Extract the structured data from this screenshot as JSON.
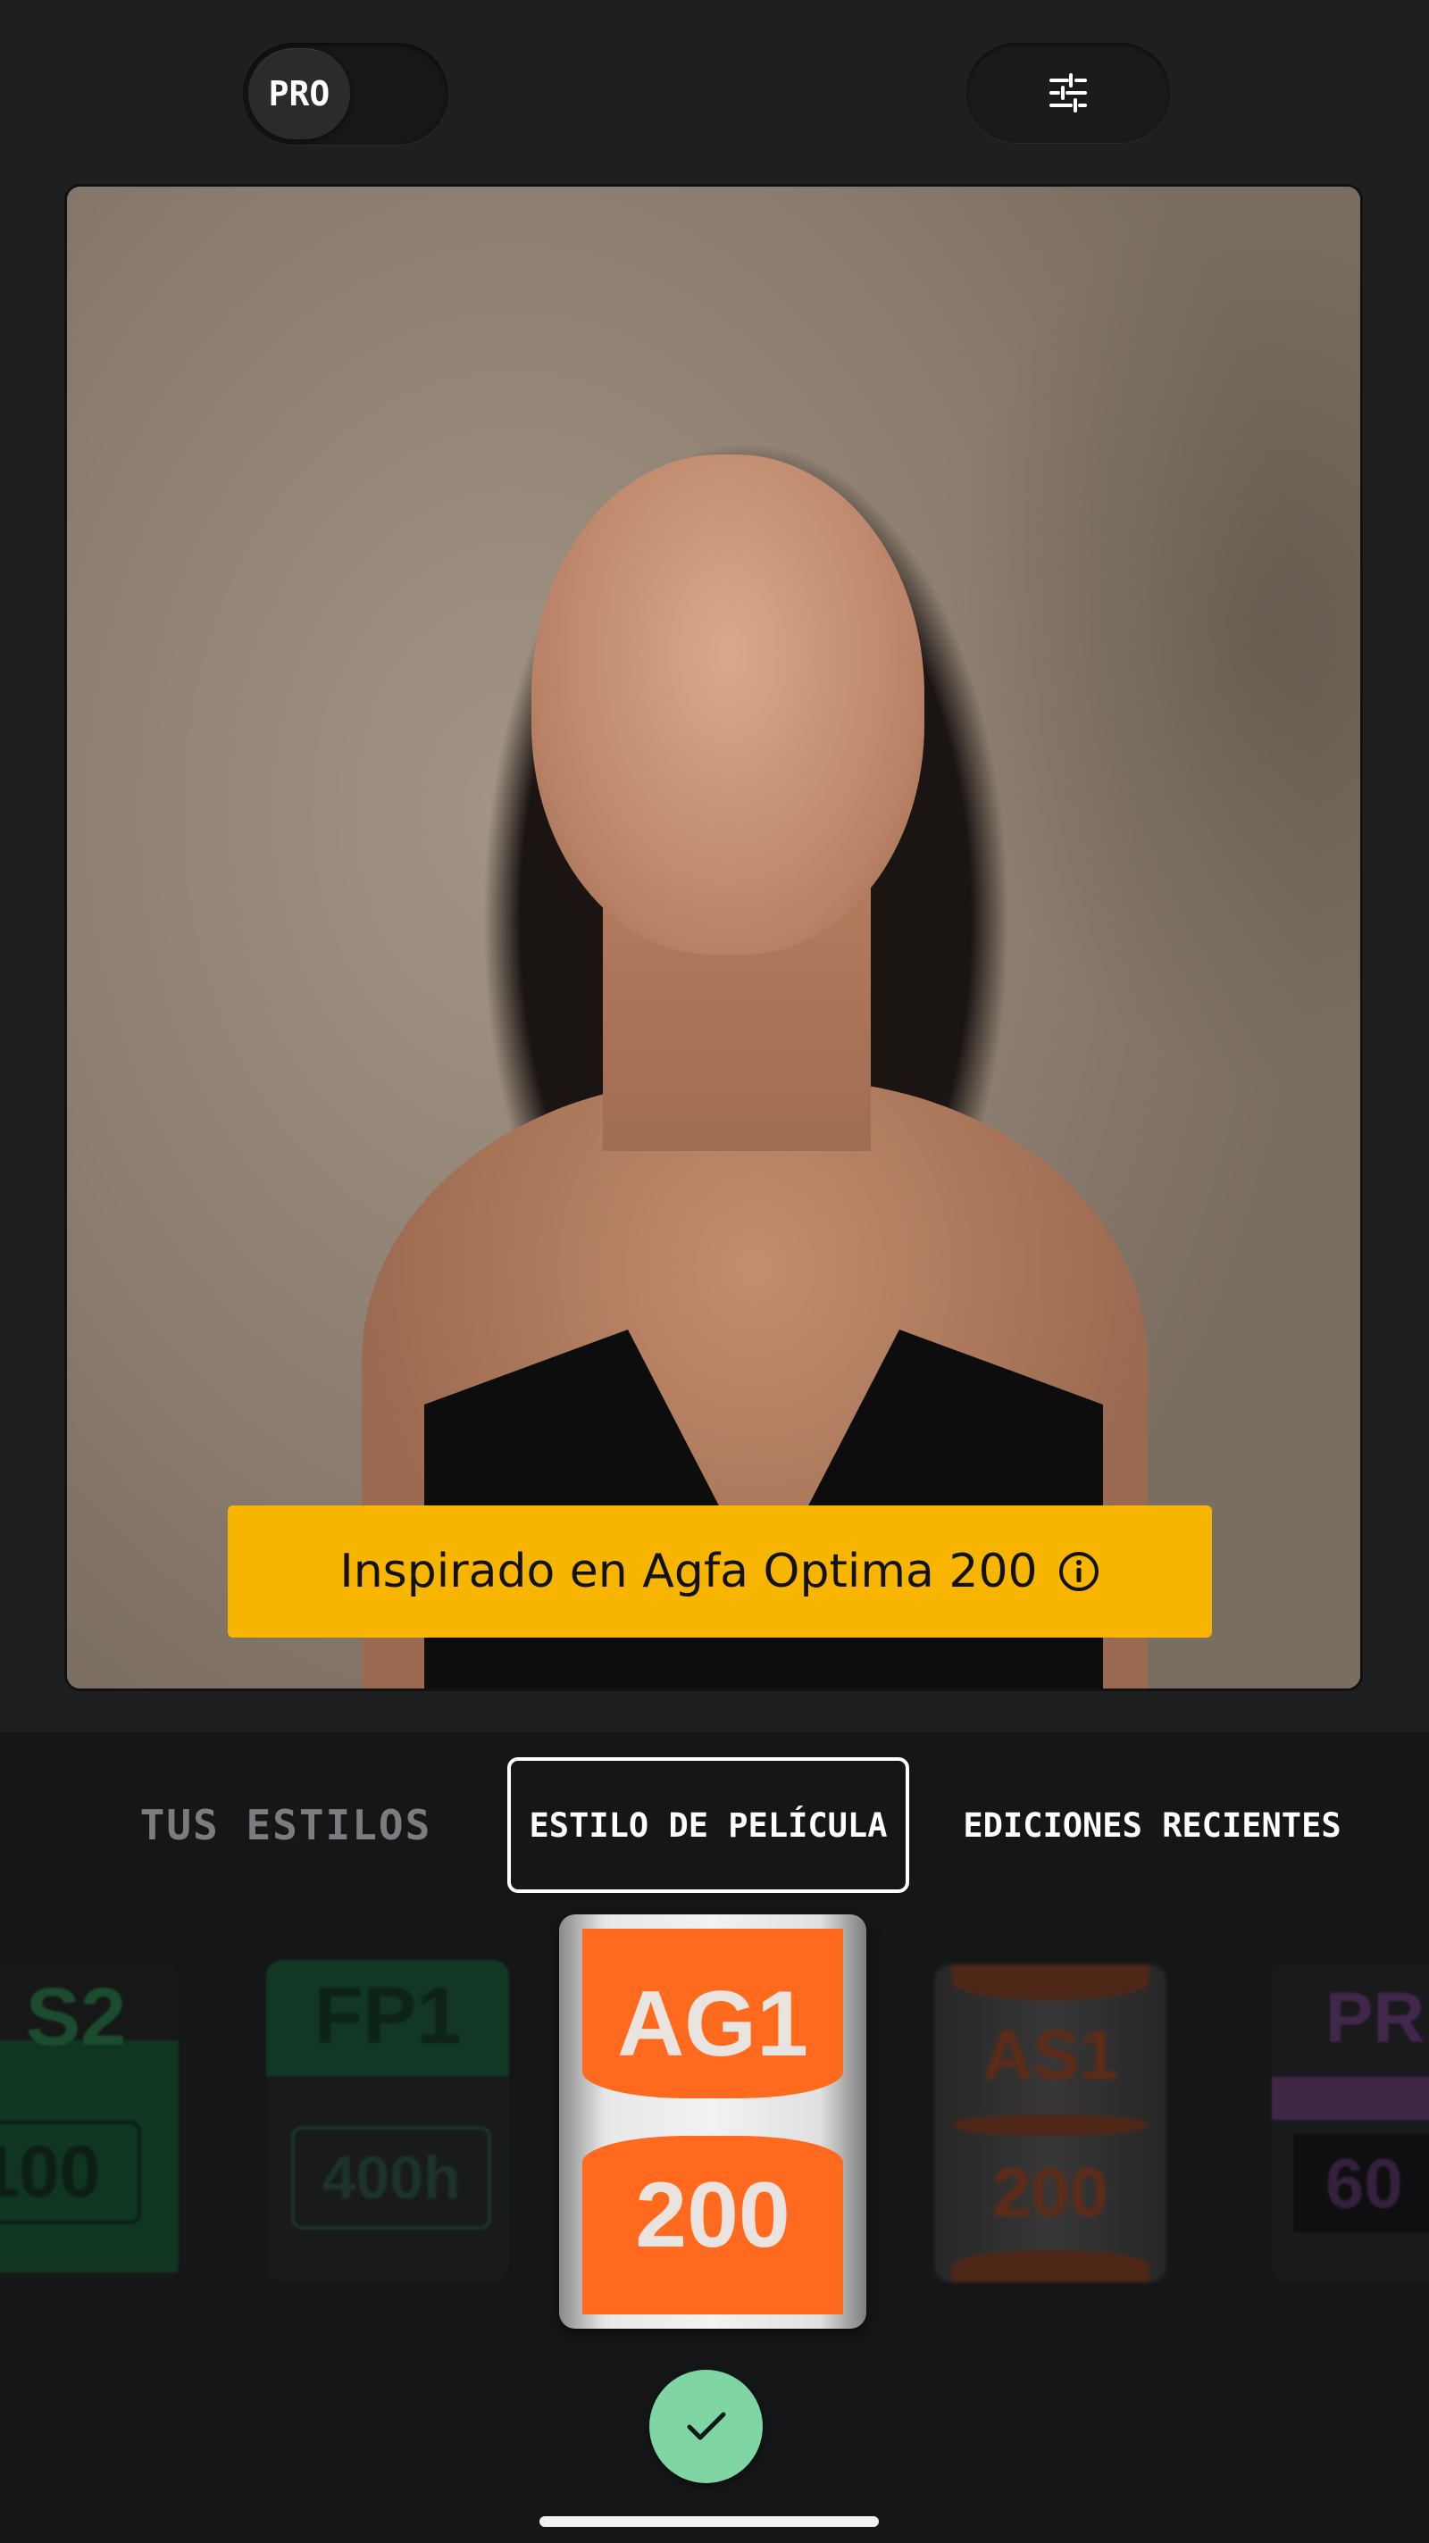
{
  "header": {
    "pro_label": "PRO",
    "adjust_icon": "sliders-icon"
  },
  "photo": {
    "caption": "Inspirado en Agfa Optima 200",
    "caption_icon": "info-icon",
    "caption_color": "#f7b500"
  },
  "tabs": [
    {
      "label": "TUS ESTILOS",
      "active": false
    },
    {
      "label": "ESTILO DE PELÍCULA",
      "active": true
    },
    {
      "label": "EDICIONES RECIENTES",
      "active": false
    }
  ],
  "films": [
    {
      "code": "S2",
      "iso": "100",
      "color": "#0f3d24"
    },
    {
      "code": "FP1",
      "iso": "400h",
      "color": "#123d27"
    },
    {
      "code": "AG1",
      "iso": "200",
      "color": "#ff6a1f",
      "selected": true
    },
    {
      "code": "AS1",
      "iso": "200",
      "color": "#5a2b18"
    },
    {
      "code": "PR",
      "iso": "60",
      "color": "#4a2c55"
    }
  ],
  "confirm": {
    "icon": "checkmark-icon",
    "color": "#7fd6a3"
  }
}
